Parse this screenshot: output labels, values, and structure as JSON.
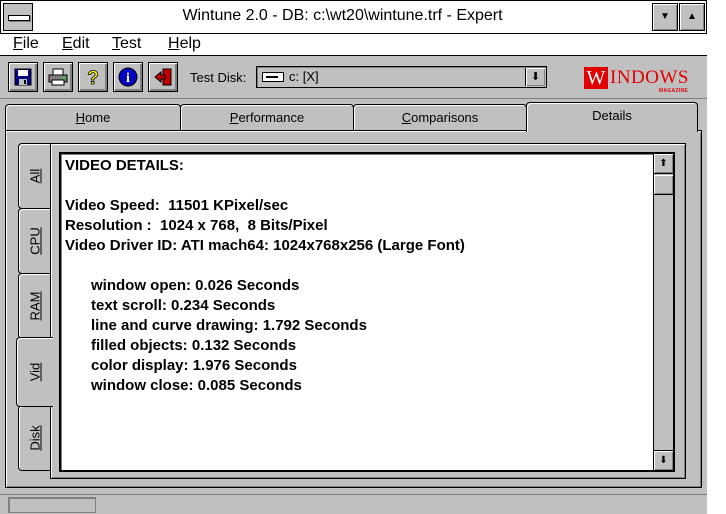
{
  "window": {
    "title": "Wintune 2.0 - DB: c:\\wt20\\wintune.trf - Expert",
    "minimize_glyph": "▼",
    "maximize_glyph": "▲"
  },
  "menu": {
    "items": [
      {
        "label": "File",
        "ul": "F",
        "rest": "ile"
      },
      {
        "label": "Edit",
        "ul": "E",
        "rest": "dit"
      },
      {
        "label": "Test",
        "ul": "T",
        "rest": "est"
      },
      {
        "label": "Help",
        "ul": "H",
        "rest": "elp"
      }
    ]
  },
  "toolbar": {
    "buttons": [
      "floppy-disk-icon",
      "printer-icon",
      "help-question-icon",
      "info-icon",
      "exit-door-icon"
    ],
    "test_disk_label": "Test Disk:",
    "test_disk_value": "c: [X]",
    "dropdown_glyph": "⬇",
    "logo_first": "W",
    "logo_rest": "INDOWS",
    "logo_sub": "MAGAZINE",
    "logo_color": "#e00000"
  },
  "tabs": [
    {
      "label": "Home",
      "ul": "H",
      "rest": "ome",
      "active": false
    },
    {
      "label": "Performance",
      "ul": "P",
      "rest": "erformance",
      "active": false
    },
    {
      "label": "Comparisons",
      "ul": "C",
      "rest": "omparisons",
      "active": false
    },
    {
      "label": "Details",
      "ul": "",
      "rest": "Details",
      "active": true
    }
  ],
  "side_tabs": [
    {
      "label": "All",
      "active": false
    },
    {
      "label": "CPU",
      "active": false
    },
    {
      "label": "RAM",
      "active": false
    },
    {
      "label": "Vid",
      "active": true
    },
    {
      "label": "Disk",
      "active": false
    }
  ],
  "details": {
    "heading": "VIDEO DETAILS:",
    "video_speed": "Video Speed:  11501 KPixel/sec",
    "resolution": "Resolution :  1024 x 768,  8 Bits/Pixel",
    "driver": "Video Driver ID: ATI mach64: 1024x768x256 (Large Font)",
    "timings": [
      "window open: 0.026 Seconds",
      "text scroll: 0.234 Seconds",
      "line and curve drawing: 1.792 Seconds",
      "filled objects: 0.132 Seconds",
      "color display: 1.976 Seconds",
      "window close: 0.085 Seconds"
    ]
  },
  "scrollbar": {
    "up_glyph": "⬆",
    "down_glyph": "⬇"
  }
}
